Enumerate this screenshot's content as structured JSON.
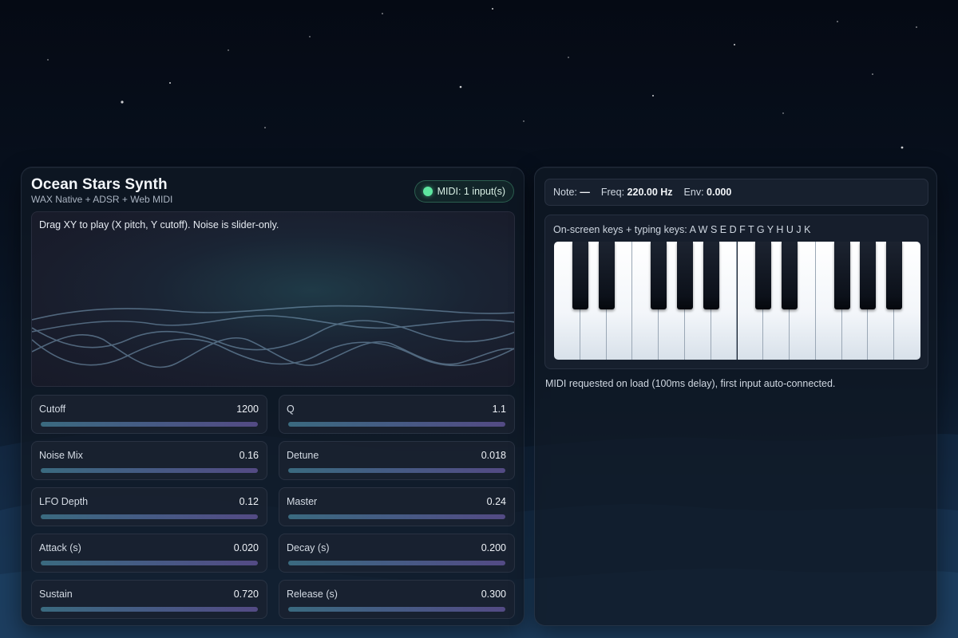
{
  "app": {
    "title": "Ocean Stars Synth",
    "subtitle": "WAX Native + ADSR + Web MIDI"
  },
  "midi_badge": {
    "label": "MIDI: 1 input(s)",
    "status_color": "#5ee6a0"
  },
  "xy_pad": {
    "hint": "Drag XY to play (X pitch, Y cutoff). Noise is slider-only."
  },
  "controls": [
    {
      "label": "Cutoff",
      "value": "1200"
    },
    {
      "label": "Q",
      "value": "1.1"
    },
    {
      "label": "Noise Mix",
      "value": "0.16"
    },
    {
      "label": "Detune",
      "value": "0.018"
    },
    {
      "label": "LFO Depth",
      "value": "0.12"
    },
    {
      "label": "Master",
      "value": "0.24"
    },
    {
      "label": "Attack (s)",
      "value": "0.020"
    },
    {
      "label": "Decay (s)",
      "value": "0.200"
    },
    {
      "label": "Sustain",
      "value": "0.720"
    },
    {
      "label": "Release (s)",
      "value": "0.300"
    }
  ],
  "status": {
    "note_label": "Note:",
    "note_value": "—",
    "freq_label": "Freq:",
    "freq_value": "220.00 Hz",
    "env_label": "Env:",
    "env_value": "0.000"
  },
  "keyboard": {
    "hint": "On-screen keys + typing keys: A W S E D F T G Y H U J K",
    "white_key_count": 14,
    "black_key_count": 10
  },
  "midi_note": "MIDI requested on load (100ms delay), first input auto-connected.",
  "colors": {
    "accent": "#5ee6a0",
    "slider_start": "#3e7288",
    "slider_end": "#5a4f8e"
  }
}
